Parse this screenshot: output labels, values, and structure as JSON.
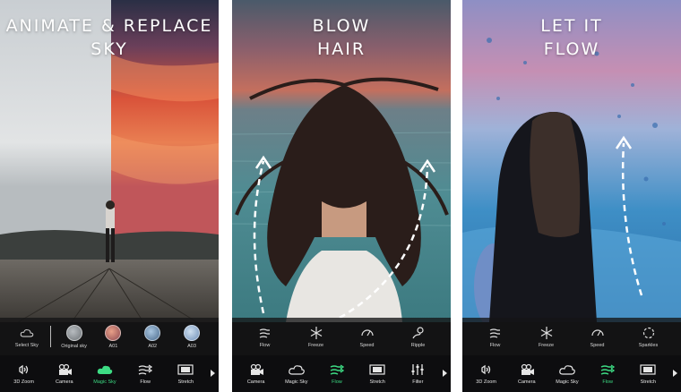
{
  "panels": [
    {
      "headline": [
        "ANIMATE & REPLACE",
        "SKY"
      ],
      "options": [
        {
          "label": "Select Sky",
          "icon": "cloud-icon"
        },
        {
          "label": "Original sky",
          "icon": "sky-thumbnail"
        },
        {
          "label": "A01",
          "icon": "sky-thumbnail"
        },
        {
          "label": "A02",
          "icon": "sky-thumbnail"
        },
        {
          "label": "A03",
          "icon": "sky-thumbnail"
        }
      ],
      "tools": [
        {
          "label": "3D Zoom",
          "icon": "zoom-3d-icon"
        },
        {
          "label": "Camera",
          "icon": "camera-icon"
        },
        {
          "label": "Magic Sky",
          "icon": "magic-sky-icon",
          "active": true
        },
        {
          "label": "Flow",
          "icon": "flow-icon"
        },
        {
          "label": "Stretch",
          "icon": "stretch-icon"
        }
      ]
    },
    {
      "headline": [
        "BLOW",
        "HAIR"
      ],
      "options": [
        {
          "label": "Flow",
          "icon": "flow-icon"
        },
        {
          "label": "Freeze",
          "icon": "snowflake-icon"
        },
        {
          "label": "Speed",
          "icon": "speedometer-icon"
        },
        {
          "label": "Ripple",
          "icon": "ripple-icon"
        }
      ],
      "tools": [
        {
          "label": "Camera",
          "icon": "camera-icon"
        },
        {
          "label": "Magic Sky",
          "icon": "magic-sky-icon"
        },
        {
          "label": "Flow",
          "icon": "flow-icon",
          "active": true
        },
        {
          "label": "Stretch",
          "icon": "stretch-icon"
        },
        {
          "label": "Filter",
          "icon": "filter-icon"
        }
      ]
    },
    {
      "headline": [
        "LET IT",
        "FLOW"
      ],
      "options": [
        {
          "label": "Flow",
          "icon": "flow-icon"
        },
        {
          "label": "Freeze",
          "icon": "snowflake-icon"
        },
        {
          "label": "Speed",
          "icon": "speedometer-icon"
        },
        {
          "label": "Sparkles",
          "icon": "sparkles-icon"
        }
      ],
      "tools": [
        {
          "label": "3D Zoom",
          "icon": "zoom-3d-icon"
        },
        {
          "label": "Camera",
          "icon": "camera-icon"
        },
        {
          "label": "Magic Sky",
          "icon": "magic-sky-icon"
        },
        {
          "label": "Flow",
          "icon": "flow-icon",
          "active": true
        },
        {
          "label": "Stretch",
          "icon": "stretch-icon"
        }
      ]
    }
  ],
  "colors": {
    "accent_active": "#3ddc84",
    "toolbar_bg": "#0d0d0f",
    "sunset_orange": "#e85a3a",
    "sea_teal": "#4f8c93",
    "sky_pink": "#c58fb3",
    "wave_blue": "#3f8fc6"
  }
}
